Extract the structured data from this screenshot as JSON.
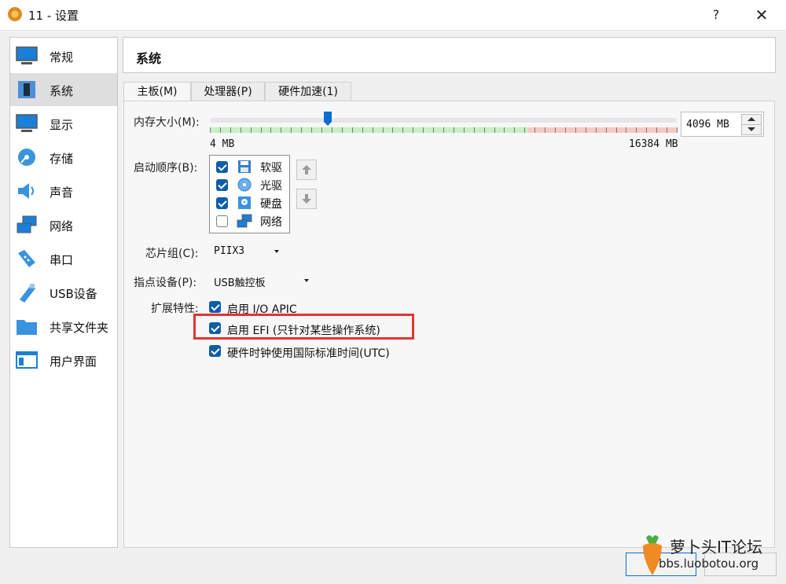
{
  "window": {
    "title": "11 - 设置",
    "help": "?",
    "close": "✕"
  },
  "sidebar": {
    "items": [
      {
        "label": "常规",
        "icon": "general-monitor-icon"
      },
      {
        "label": "系统",
        "icon": "system-chip-icon",
        "selected": true
      },
      {
        "label": "显示",
        "icon": "display-monitor-icon"
      },
      {
        "label": "存储",
        "icon": "storage-disk-icon"
      },
      {
        "label": "声音",
        "icon": "speaker-icon"
      },
      {
        "label": "网络",
        "icon": "network-icon"
      },
      {
        "label": "串口",
        "icon": "serial-port-icon"
      },
      {
        "label": "USB设备",
        "icon": "usb-icon"
      },
      {
        "label": "共享文件夹",
        "icon": "shared-folder-icon"
      },
      {
        "label": "用户界面",
        "icon": "user-interface-icon"
      }
    ]
  },
  "header": {
    "title": "系统"
  },
  "tabs": [
    {
      "label": "主板(M)",
      "active": true
    },
    {
      "label": "处理器(P)"
    },
    {
      "label": "硬件加速(1)"
    }
  ],
  "motherboard": {
    "memory": {
      "label": "内存大小(M):",
      "min_label": "4 MB",
      "max_label": "16384 MB",
      "value": "4096 MB",
      "value_mb": 4096,
      "min_mb": 4,
      "max_mb": 16384
    },
    "boot_order": {
      "label": "启动顺序(B):",
      "items": [
        {
          "label": "软驱",
          "checked": true,
          "icon": "floppy-icon"
        },
        {
          "label": "光驱",
          "checked": true,
          "icon": "optical-disc-icon"
        },
        {
          "label": "硬盘",
          "checked": true,
          "icon": "hard-disk-icon"
        },
        {
          "label": "网络",
          "checked": false,
          "icon": "network-icon"
        }
      ]
    },
    "chipset": {
      "label": "芯片组(C):",
      "value": "PIIX3"
    },
    "pointing": {
      "label": "指点设备(P):",
      "value": "USB触控板"
    },
    "extended": {
      "label": "扩展特性:",
      "options": [
        {
          "label": "启用 I/O APIC",
          "checked": true
        },
        {
          "label": "启用 EFI (只针对某些操作系统)",
          "checked": true
        },
        {
          "label": "硬件时钟使用国际标准时间(UTC)",
          "checked": true
        }
      ]
    }
  },
  "watermark": {
    "title": "萝卜头IT论坛",
    "url": "bbs.luobotou.org"
  },
  "colors": {
    "accent": "#0d5ea8",
    "highlight": "#e63232",
    "green_range": "#c9efc7",
    "red_range": "#f7c8c4"
  }
}
